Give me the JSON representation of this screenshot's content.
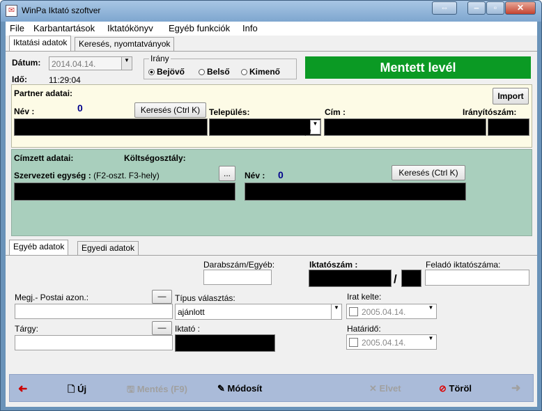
{
  "window": {
    "title": "WinPa Iktató szoftver"
  },
  "menu": [
    "File",
    "Karbantartások",
    "Iktatókönyv",
    "Egyéb funkciók",
    "Info"
  ],
  "top_tabs": [
    "Iktatási adatok",
    "Keresés, nyomtatványok"
  ],
  "header": {
    "datum_label": "Dátum:",
    "datum_value": "2014.04.14.",
    "ido_label": "Idő:",
    "ido_value": "11:29:04",
    "irany_label": "Irány",
    "irany_options": [
      "Bejövő",
      "Belső",
      "Kimenő"
    ],
    "irany_selected": "Bejövő",
    "status_banner": "Mentett levél",
    "status_color": "#0b9a24"
  },
  "partner": {
    "section_title": "Partner adatai:",
    "nev_label": "Név :",
    "count": "0",
    "search_button": "Keresés (Ctrl K)",
    "import_button": "Import",
    "telepules_label": "Település:",
    "cim_label": "Cím :",
    "iranyitoszam_label": "Irányítószám:"
  },
  "cimzett": {
    "section_title": "Címzett adatai:",
    "koltseg_label": "Költségosztály:",
    "szerv_label": "Szervezeti egység :",
    "szerv_hint": "(F2-oszt. F3-hely)",
    "ellipsis_button": "...",
    "nev_label": "Név :",
    "count": "0",
    "search_button": "Keresés (Ctrl K)"
  },
  "bottom_tabs": [
    "Egyéb adatok",
    "Egyedi adatok"
  ],
  "details": {
    "darabszam_label": "Darabszám/Egyéb:",
    "iktatoszam_label": "Iktatószám :",
    "iktatoszam_sep": "/",
    "felado_label": "Feladó iktatószáma:",
    "megj_label": "Megj.- Postai azon.:",
    "dash_button": "—",
    "tipus_label": "Típus választás:",
    "tipus_value": "ajánlott",
    "irat_kelte_label": "Irat kelte:",
    "irat_kelte_value": "2005.04.14.",
    "targy_label": "Tárgy:",
    "iktato_label": "Iktató :",
    "hatarido_label": "Határidő:",
    "hatarido_value": "2005.04.14."
  },
  "toolbar": {
    "back_icon": "arrow-left-icon",
    "new_label": "Új",
    "save_label": "Mentés (F9)",
    "modify_label": "Módosít",
    "discard_label": "Elvet",
    "delete_label": "Töröl",
    "forward_icon": "arrow-right-icon"
  }
}
